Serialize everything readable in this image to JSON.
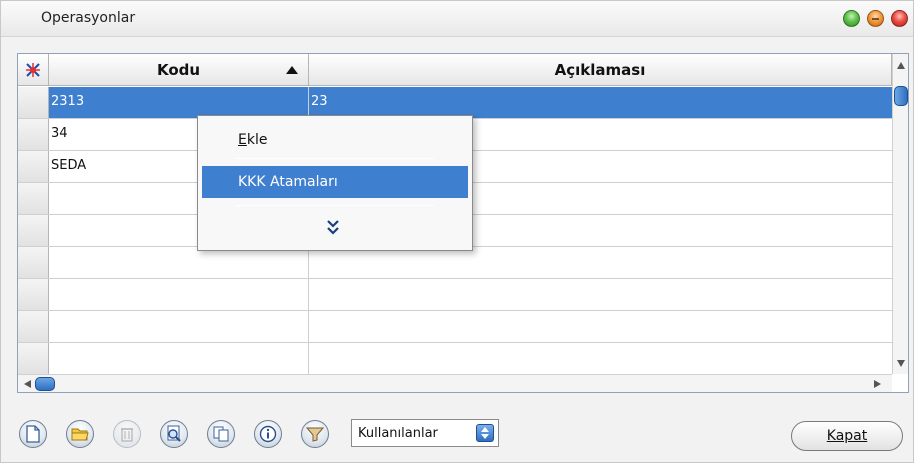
{
  "window": {
    "title": "Operasyonlar"
  },
  "grid": {
    "columns": [
      "Kodu",
      "Açıklaması"
    ],
    "sort_column": "Kodu",
    "sort_direction": "ascending",
    "rows": [
      {
        "kodu": "2313",
        "aciklama": "23",
        "selected": true
      },
      {
        "kodu": "34",
        "aciklama": ""
      },
      {
        "kodu": "SEDA",
        "aciklama": ""
      },
      {
        "kodu": "",
        "aciklama": ""
      },
      {
        "kodu": "",
        "aciklama": ""
      },
      {
        "kodu": "",
        "aciklama": ""
      },
      {
        "kodu": "",
        "aciklama": ""
      },
      {
        "kodu": "",
        "aciklama": ""
      },
      {
        "kodu": "",
        "aciklama": ""
      }
    ]
  },
  "context_menu": {
    "items": [
      {
        "label": "Ekle",
        "accelerator": "E"
      },
      {
        "label": "KKK Atamaları",
        "highlighted": true
      }
    ],
    "more_icon": "double-chevron-down-icon"
  },
  "toolbar": {
    "buttons": [
      "new-icon",
      "open-icon",
      "delete-icon",
      "search-icon",
      "copy-icon",
      "info-icon",
      "filter-icon"
    ],
    "combo_value": "Kullanılanlar",
    "close_label": "Kapat"
  },
  "colors": {
    "selection": "#3f7fd0",
    "accent": "#2f6fc0"
  }
}
